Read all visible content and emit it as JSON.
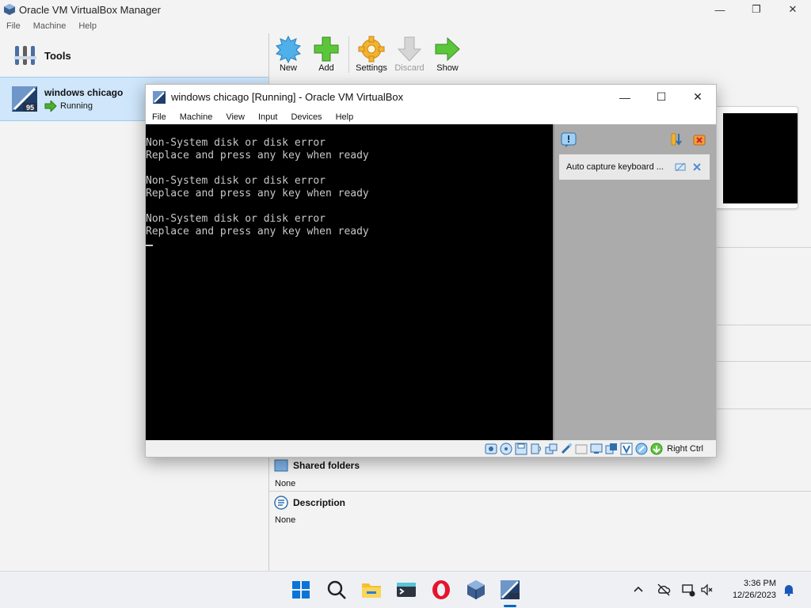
{
  "manager": {
    "title": "Oracle VM VirtualBox Manager",
    "menu": [
      "File",
      "Machine",
      "Help"
    ],
    "tools_label": "Tools",
    "vm": {
      "name": "windows chicago",
      "status": "Running",
      "badge": "95"
    },
    "toolbar": {
      "new": "New",
      "add": "Add",
      "settings": "Settings",
      "discard": "Discard",
      "show": "Show"
    },
    "sections": {
      "shared_folders": {
        "title": "Shared folders",
        "value": "None"
      },
      "description": {
        "title": "Description",
        "value": "None"
      }
    }
  },
  "vm_window": {
    "title": "windows chicago [Running] - Oracle VM VirtualBox",
    "menu": [
      "File",
      "Machine",
      "View",
      "Input",
      "Devices",
      "Help"
    ],
    "console_lines": [
      "Non-System disk or disk error",
      "Replace and press any key when ready",
      "",
      "Non-System disk or disk error",
      "Replace and press any key when ready",
      "",
      "Non-System disk or disk error",
      "Replace and press any key when ready"
    ],
    "notification": "Auto capture keyboard ...",
    "host_key": "Right Ctrl"
  },
  "taskbar": {
    "time": "3:36 PM",
    "date": "12/26/2023",
    "apps": [
      "start-icon",
      "search-icon",
      "file-explorer-icon",
      "terminal-icon",
      "opera-icon",
      "virtualbox-icon",
      "vm-window-icon"
    ]
  },
  "colors": {
    "selection": "#cfe6fb",
    "console_bg": "#000000",
    "console_text": "#c8c8c8",
    "notification_pane": "#ababab",
    "accent": "#0067c0"
  }
}
